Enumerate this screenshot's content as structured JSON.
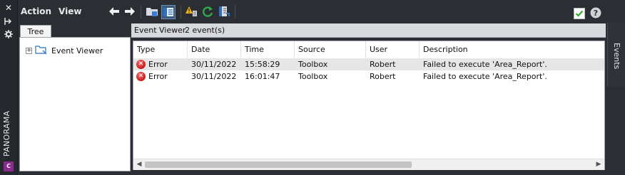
{
  "sidebar": {
    "label": "PANORAMA",
    "badge": "C"
  },
  "toolbar": {
    "menu_action": "Action",
    "menu_view": "View"
  },
  "tree": {
    "tab_label": "Tree",
    "root_label": "Event Viewer"
  },
  "main": {
    "title": "Event Viewer",
    "count": "2 event(s)",
    "columns": [
      "Type",
      "Date",
      "Time",
      "Source",
      "User",
      "Description"
    ],
    "rows": [
      {
        "type": "Error",
        "date": "30/11/2022",
        "time": "15:58:29",
        "source": "Toolbox",
        "user": "Robert",
        "description": "Failed to execute 'Area_Report'."
      },
      {
        "type": "Error",
        "date": "30/11/2022",
        "time": "16:01:47",
        "source": "Toolbox",
        "user": "Robert",
        "description": "Failed to execute 'Area_Report'."
      }
    ]
  },
  "right_panel": {
    "tab_label": "Events"
  },
  "colors": {
    "error": "#c41b1b",
    "check": "#3aa832",
    "refresh": "#2eaa4a",
    "warning": "#f2b70d",
    "accent": "#8a2a8f"
  }
}
